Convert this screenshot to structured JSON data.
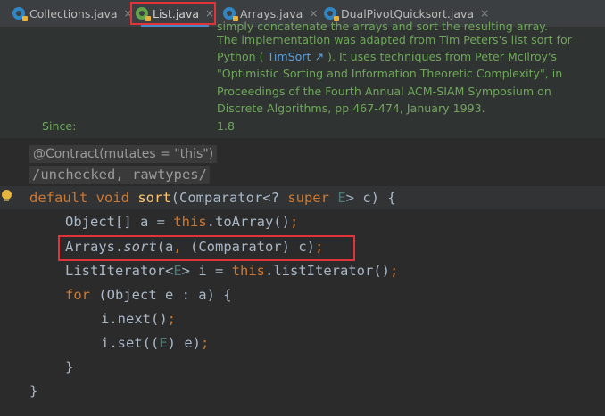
{
  "tabs": [
    {
      "label": "Collections.java",
      "icon": "java-class-icon",
      "active": false
    },
    {
      "label": "List.java",
      "icon": "java-interface-icon",
      "active": true
    },
    {
      "label": "Arrays.java",
      "icon": "java-class-icon",
      "active": false
    },
    {
      "label": "DualPivotQuicksort.java",
      "icon": "java-class-icon",
      "active": false
    }
  ],
  "tab_close_glyph": "×",
  "javadoc": {
    "cut_line": "simply concatenate the arrays and sort the resulting array.",
    "line1": "The implementation was adapted from Tim Peters's list sort for",
    "line2_prefix": "Python ( ",
    "link": "TimSort",
    "link_arrow": "↗",
    "line2_suffix": " ). It uses techniques from Peter McIlroy's",
    "line3": "\"Optimistic Sorting and Information Theoretic Complexity\", in",
    "line4": "Proceedings of the Fourth Annual ACM-SIAM Symposium on",
    "line5": "Discrete Algorithms, pp 467-474, January 1993.",
    "since_label": "Since:",
    "since_value": "1.8"
  },
  "code": {
    "annotation": "@Contract(mutates = \"this\")",
    "suppress": "/unchecked, rawtypes/",
    "l1_kw": "default void ",
    "l1_fn": "sort",
    "l1_a": "(Comparator<? ",
    "l1_super": "super ",
    "l1_E": "E",
    "l1_b": "> c) {",
    "l2_a": "Object[] a = ",
    "l2_this": "this",
    "l2_b": ".toArray()",
    "l2_semi": ";",
    "l3_a": "Arrays.",
    "l3_sort": "sort",
    "l3_b": "(a",
    "l3_comma": ",",
    "l3_c": " (Comparator) c)",
    "l3_semi": ";",
    "l4_a": "ListIterator<",
    "l4_E": "E",
    "l4_b": "> i = ",
    "l4_this": "this",
    "l4_c": ".listIterator()",
    "l4_semi": ";",
    "l5_for": "for ",
    "l5_a": "(Object e : a) {",
    "l6_a": "i.next()",
    "l6_semi": ";",
    "l7_a": "i.set((",
    "l7_E": "E",
    "l7_b": ") e)",
    "l7_semi": ";",
    "l8": "}",
    "l9": "}"
  },
  "colors": {
    "keyword": "#cc7832",
    "method": "#ffc66d",
    "doc_text": "#6fa75a",
    "highlight_box": "#e0343a"
  }
}
